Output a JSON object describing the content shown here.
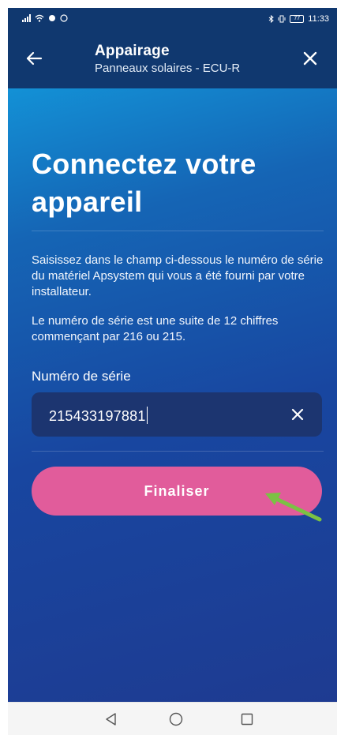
{
  "status_bar": {
    "time": "11:33",
    "battery": "77",
    "icons": [
      "signal-icon",
      "wifi-icon",
      "notification-icon",
      "whatsapp-icon",
      "bluetooth-icon",
      "vibrate-icon",
      "battery-icon"
    ]
  },
  "header": {
    "title": "Appairage",
    "subtitle": "Panneaux solaires - ECU-R",
    "back_icon": "back-arrow-icon",
    "close_icon": "close-icon"
  },
  "main": {
    "title": "Connectez votre appareil",
    "description": "Saisissez dans le champ ci-dessous le numéro de série du matériel Apsystem qui vous a été fourni par votre installateur.",
    "hint": "Le numéro de série est une suite de 12 chiffres commençant par 216 ou 215.",
    "field_label": "Numéro de série",
    "serial_value": "215433197881",
    "finalize_label": "Finaliser"
  },
  "colors": {
    "header_bg": "#10386f",
    "button_bg": "#e15c9b",
    "field_bg": "#1c3570",
    "annotation_arrow": "#7bc144"
  },
  "nav_bar": {
    "buttons": [
      "back-triangle-icon",
      "home-circle-icon",
      "recents-square-icon"
    ]
  }
}
